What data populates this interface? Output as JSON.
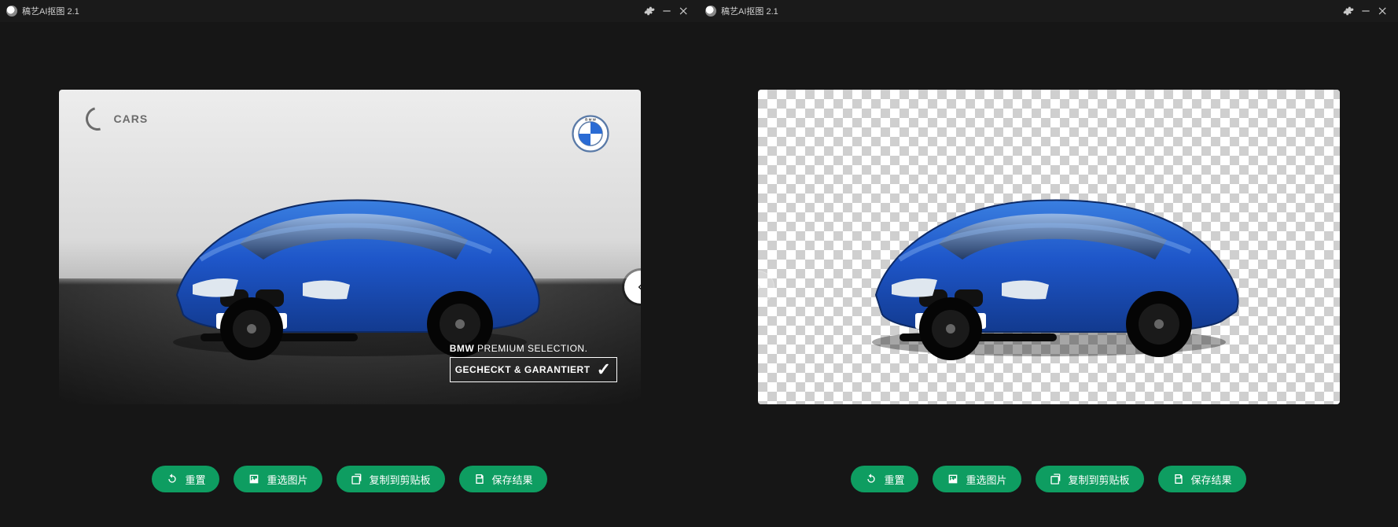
{
  "app": {
    "title": "稿艺AI抠图 2.1"
  },
  "left_panel": {
    "overlays": {
      "cars_logo_text": "CARS",
      "premium_line1_brand": "BMW",
      "premium_line1_rest": " PREMIUM SELECTION.",
      "premium_line2": "GECHECKT & GARANTIERT"
    }
  },
  "toolbar": {
    "reset_label": "重置",
    "reselect_label": "重选图片",
    "copy_label": "复制到剪贴板",
    "save_label": "保存结果"
  },
  "icons": {
    "gear": "gear-icon",
    "minimize": "minimize-icon",
    "close": "close-icon",
    "reset": "reset-icon",
    "image": "image-icon",
    "copy": "copy-icon",
    "save": "save-icon",
    "chevron_left": "chevron-left-icon",
    "chevron_right": "chevron-right-icon",
    "bmw": "bmw-roundel-icon",
    "cars_logo": "cars-logo-icon"
  }
}
